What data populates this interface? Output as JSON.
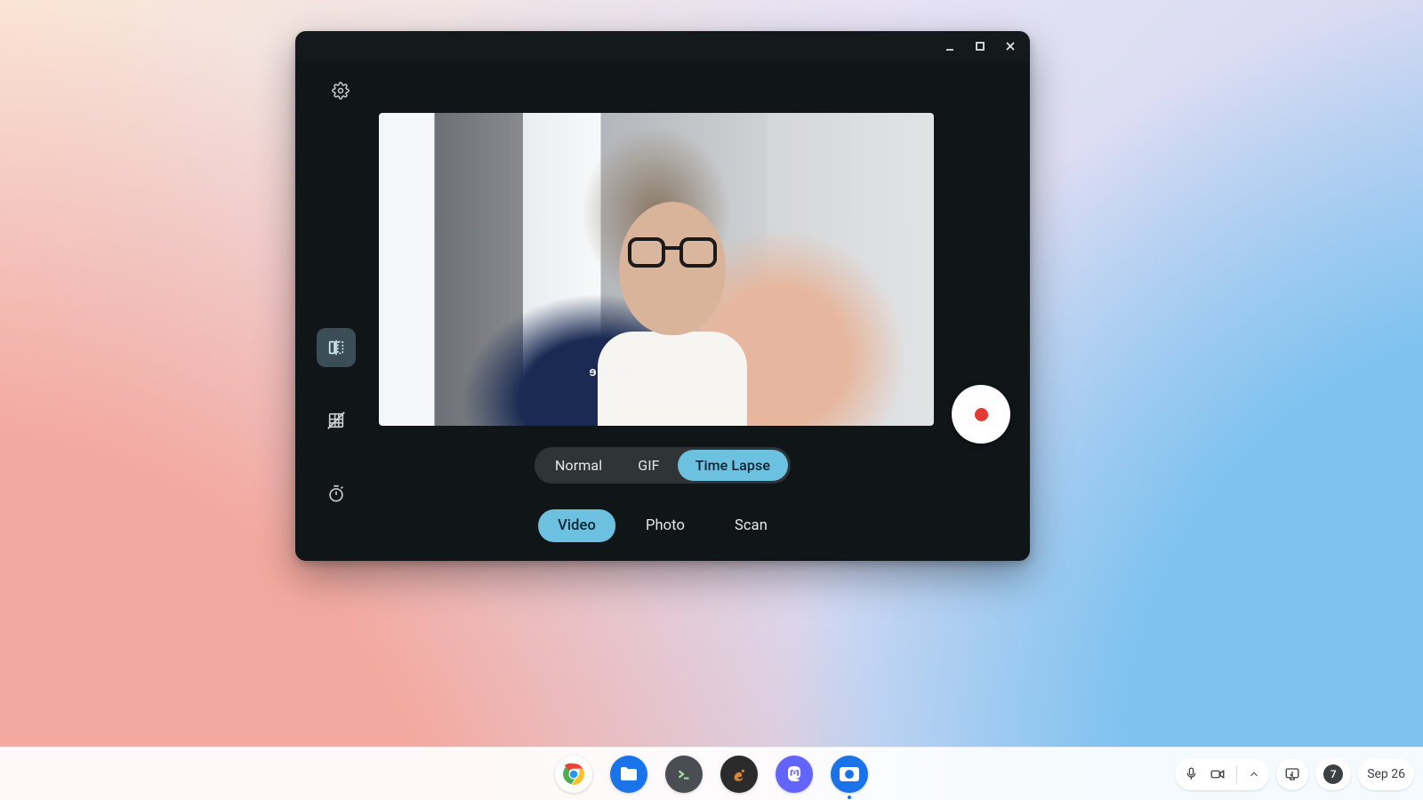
{
  "window": {
    "left_tools": {
      "settings": "Settings",
      "mirror": "Mirror",
      "grid": "Grid",
      "timer": "Timer",
      "active": "mirror"
    },
    "video_modes": {
      "items": [
        "Normal",
        "GIF",
        "Time Lapse"
      ],
      "active_index": 2
    },
    "capture_modes": {
      "items": [
        "Video",
        "Photo",
        "Scan"
      ],
      "active_index": 0
    },
    "viewfinder_text": "Google",
    "record": "Record"
  },
  "shelf": {
    "apps": [
      {
        "id": "chrome",
        "name": "Chrome"
      },
      {
        "id": "files",
        "name": "Files"
      },
      {
        "id": "terminal",
        "name": "Terminal"
      },
      {
        "id": "squirrel",
        "name": "App"
      },
      {
        "id": "mastodon",
        "name": "Mastodon"
      },
      {
        "id": "camera",
        "name": "Camera"
      }
    ],
    "tray": {
      "mic": "Microphone",
      "cam": "Camera in use",
      "expand": "Quick settings",
      "screenshot": "Screen capture",
      "notif_count": "7",
      "date": "Sep 26"
    }
  },
  "colors": {
    "accent": "#6cc0e0",
    "window_bg": "#101518"
  }
}
